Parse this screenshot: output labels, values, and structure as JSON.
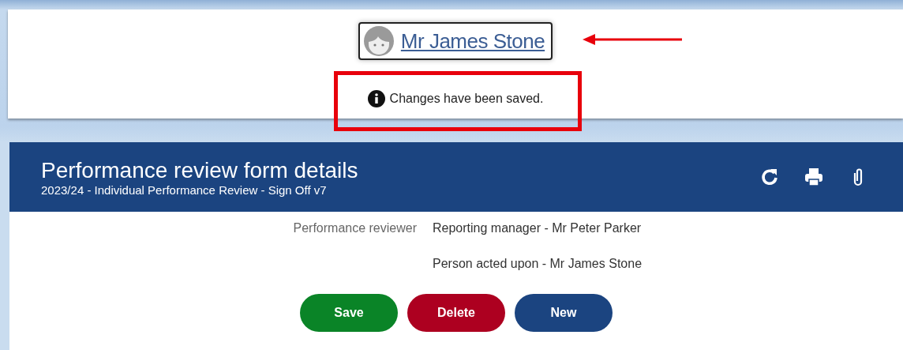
{
  "profile": {
    "name": "Mr James Stone"
  },
  "message": {
    "text": "Changes have been saved."
  },
  "highlights": {
    "arrow": true,
    "box": true
  },
  "header": {
    "title": "Performance review form details",
    "subtitle": "2023/24 - Individual Performance Review - Sign Off v7",
    "tools": [
      {
        "kind": "refresh"
      },
      {
        "kind": "print"
      },
      {
        "kind": "attach"
      }
    ]
  },
  "fields": [
    {
      "label": "Performance reviewer",
      "value": "Reporting manager - Mr Peter Parker"
    },
    {
      "value": "Person acted upon - Mr James Stone"
    }
  ],
  "buttons": [
    {
      "label": "Save",
      "kind": "success"
    },
    {
      "label": "Delete",
      "kind": "danger"
    },
    {
      "label": "New",
      "kind": "primary"
    }
  ]
}
